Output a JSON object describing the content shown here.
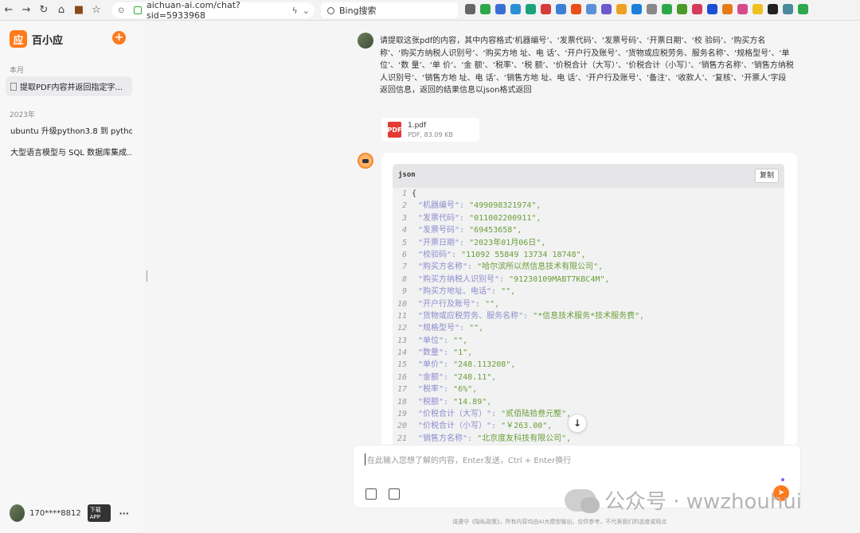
{
  "browser": {
    "url": "aichuan-ai.com/chat?sid=5933968",
    "search_placeholder": "Bing搜索"
  },
  "sidebar": {
    "app_name": "百小应",
    "logo_char": "应",
    "new_chat": "+",
    "sections": [
      {
        "label": "本月",
        "items": [
          "提取PDF内容并返回指定字..."
        ]
      },
      {
        "label": "2023年",
        "items": [
          "ubuntu 升级python3.8 到 pytho...",
          "大型语言模型与 SQL 数据库集成..."
        ]
      }
    ],
    "user": {
      "name": "170****8812",
      "download_badge": "下载APP",
      "more": "···"
    }
  },
  "chat": {
    "user_message": "请提取这张pdf的内容，其中内容格式‘机器编号’、‘发票代码’、‘发票号码’、‘开票日期’、‘校 验码’、‘购买方名称’、‘购买方纳税人识别号’、‘购买方地 址、电 话’、‘开户行及账号’、‘货物或应税劳务、服务名称’、‘规格型号’、‘单 位’、‘数 量’、‘单 价’、‘金 额’、‘税率’、‘税 额’、‘价税合计（大写）’、‘价税合计（小写）’、‘销售方名称’、‘销售方纳税人识别号’、‘销售方地 址、电 话’、‘销售方地 址、电 话’、‘开户行及账号’、‘备注’、‘收款人’、‘复核’、‘开票人’字段返回信息，返回的结果信息以json格式返回",
    "file": {
      "name": "1.pdf",
      "meta": "PDF, 83.09 KB",
      "icon_text": "PDF"
    },
    "code": {
      "lang": "json",
      "copy_label": "复制",
      "lines": [
        {
          "n": "1",
          "k": "",
          "v": "{"
        },
        {
          "n": "2",
          "k": "\"机器编号\": ",
          "v": "\"499098321974\","
        },
        {
          "n": "3",
          "k": "\"发票代码\": ",
          "v": "\"011002200911\","
        },
        {
          "n": "4",
          "k": "\"发票号码\": ",
          "v": "\"69453658\","
        },
        {
          "n": "5",
          "k": "\"开票日期\": ",
          "v": "\"2023年01月06日\","
        },
        {
          "n": "6",
          "k": "\"校验码\": ",
          "v": "\"11092 55849 13734 18748\","
        },
        {
          "n": "7",
          "k": "\"购买方名称\": ",
          "v": "\"哈尔滨所以然信息技术有限公司\","
        },
        {
          "n": "8",
          "k": "\"购买方纳税人识别号\": ",
          "v": "\"91230109MABT7KBC4M\","
        },
        {
          "n": "9",
          "k": "\"购买方地址、电话\": ",
          "v": "\"\","
        },
        {
          "n": "10",
          "k": "\"开户行及账号\": ",
          "v": "\"\","
        },
        {
          "n": "11",
          "k": "\"货物或应税劳务、服务名称\": ",
          "v": "\"*信息技术服务*技术服务费\","
        },
        {
          "n": "12",
          "k": "\"规格型号\": ",
          "v": "\"\","
        },
        {
          "n": "13",
          "k": "\"单位\": ",
          "v": "\"\","
        },
        {
          "n": "14",
          "k": "\"数量\": ",
          "v": "\"1\","
        },
        {
          "n": "15",
          "k": "\"单价\": ",
          "v": "\"248.113208\","
        },
        {
          "n": "16",
          "k": "\"金额\": ",
          "v": "\"248.11\","
        },
        {
          "n": "17",
          "k": "\"税率\": ",
          "v": "\"6%\","
        },
        {
          "n": "18",
          "k": "\"税额\": ",
          "v": "\"14.89\","
        },
        {
          "n": "19",
          "k": "\"价税合计（大写）\": ",
          "v": "\"贰佰陆拾叁元整\","
        },
        {
          "n": "20",
          "k": "\"价税合计（小写）\": ",
          "v": "\"￥263.00\","
        },
        {
          "n": "21",
          "k": "\"销售方名称\": ",
          "v": "\"北京度友科技有限公司\","
        }
      ]
    },
    "input_placeholder": "在此输入您想了解的内容，Enter发送，Ctrl + Enter换行",
    "scroll_down": "↓",
    "send": "➤"
  },
  "watermark": "公众号 · wwzhouhui",
  "footer": "请遵守《隐私政策》，所有内容均由AI大模型输出，仅供参考，不代表我们的态度或观点",
  "colors": {
    "accent": "#ff7a1a",
    "code_key": "#8c8ccc",
    "code_value": "#6a9f38"
  }
}
